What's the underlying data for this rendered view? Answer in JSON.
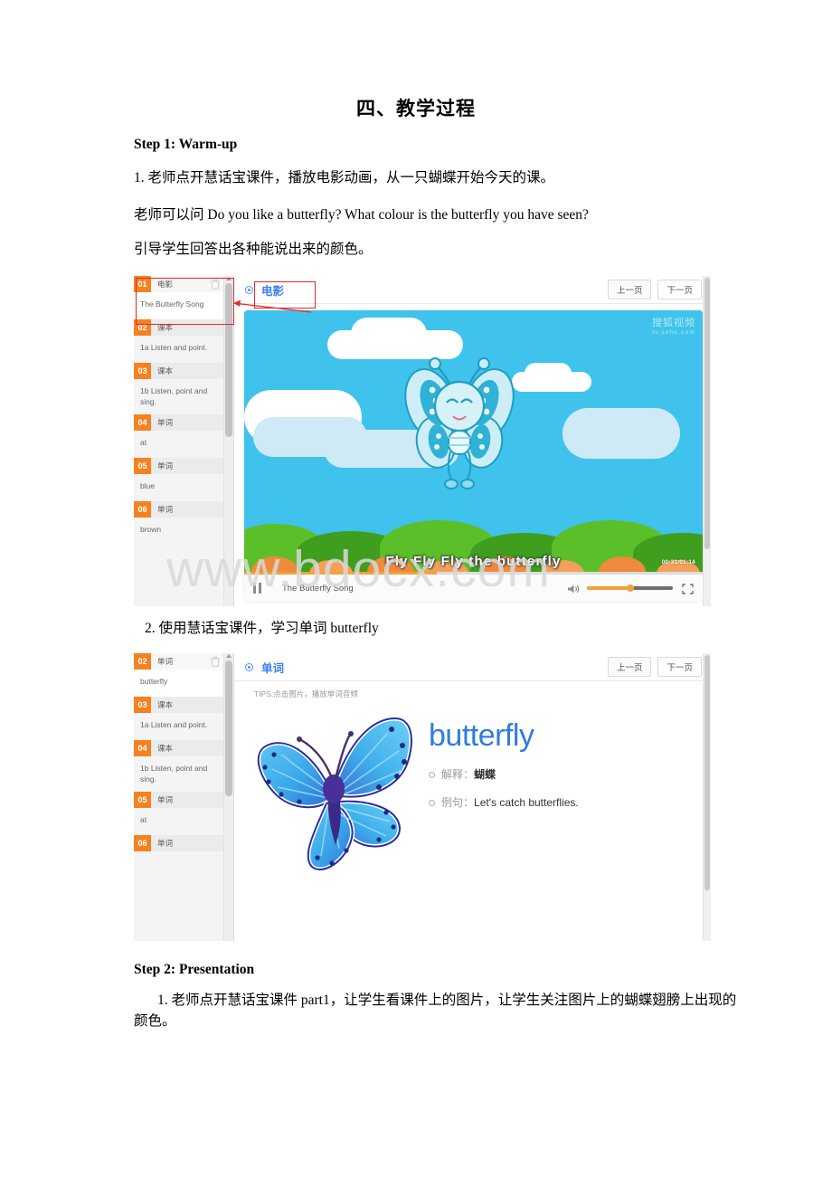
{
  "document": {
    "title": "四、教学过程",
    "step1_heading": "Step 1: Warm-up",
    "para1": "1. 老师点开慧话宝课件，播放电影动画，从一只蝴蝶开始今天的课。",
    "para2": "老师可以问 Do you like a butterfly? What colour is the butterfly you have seen?",
    "para3": "引导学生回答出各种能说出来的颜色。",
    "para4": "2. 使用慧话宝课件，学习单词 butterfly",
    "step2_heading": "Step 2: Presentation",
    "para5": "1. 老师点开慧话宝课件 part1，让学生看课件上的图片，让学生关注图片上的蝴蝶翅膀上出现的颜色。",
    "watermark": "www.bdocx.com"
  },
  "screenshot1": {
    "header": {
      "title": "电影",
      "prev_label": "上一页",
      "next_label": "下一页"
    },
    "sidebar": {
      "items": [
        {
          "num": "01",
          "type": "电影",
          "body": "The Butterfly Song",
          "active": true
        },
        {
          "num": "02",
          "type": "课本",
          "body": "1a Listen and point.",
          "active": false
        },
        {
          "num": "03",
          "type": "课本",
          "body": "1b Listen, point and sing.",
          "active": false
        },
        {
          "num": "04",
          "type": "单词",
          "body": "at",
          "active": false
        },
        {
          "num": "05",
          "type": "单词",
          "body": "blue",
          "active": false
        },
        {
          "num": "06",
          "type": "单词",
          "body": "brown",
          "active": false
        }
      ]
    },
    "video": {
      "subtitle": "Fly Fly Fly the butterfly",
      "time": "00:31/01:14",
      "track_title": "The Butterfly Song",
      "watermark_cn": "搜狐视频",
      "watermark_url": "tv.sohu.com"
    }
  },
  "screenshot2": {
    "header": {
      "title": "单词",
      "prev_label": "上一页",
      "next_label": "下一页"
    },
    "tips": "TIPS:点击图片，播放单词音频",
    "sidebar": {
      "items": [
        {
          "num": "02",
          "type": "单词",
          "body": "butterfly",
          "active": true
        },
        {
          "num": "03",
          "type": "课本",
          "body": "1a Listen and point.",
          "active": false
        },
        {
          "num": "04",
          "type": "课本",
          "body": "1b Listen, point and sing.",
          "active": false
        },
        {
          "num": "05",
          "type": "单词",
          "body": "at",
          "active": false
        },
        {
          "num": "06",
          "type": "单词",
          "body": "",
          "active": false
        }
      ]
    },
    "word_card": {
      "word": "butterfly",
      "meaning_label": "解释：",
      "meaning_value": "蝴蝶",
      "example_label": "例句：",
      "example_value": "Let's catch butterflies."
    }
  },
  "colors": {
    "orange": "#f58220",
    "blue": "#3d7ff5",
    "red_annotation": "#e8262d",
    "sky": "#3fc3ec"
  }
}
